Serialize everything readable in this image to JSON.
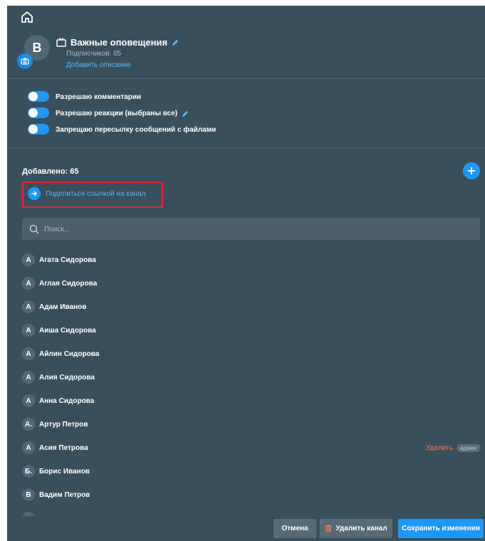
{
  "channel": {
    "avatar_letter": "B",
    "title": "Важные оповещения",
    "subscribers": "Подписчиков: 65",
    "add_description": "Добавить описание"
  },
  "options": [
    {
      "label": "Разрешаю комментарии",
      "enabled": true
    },
    {
      "label": "Разрешаю реакции (выбраны все)",
      "enabled": true
    },
    {
      "label": "Запрещаю пересылку сообщений с файлами",
      "enabled": true
    }
  ],
  "members_section": {
    "added": "Добавлено: 65",
    "share_link": "Поделиться ссылкой на канал"
  },
  "search": {
    "placeholder": "Поиск..."
  },
  "members": [
    {
      "initial": "А",
      "name": "Агата Сидорова"
    },
    {
      "initial": "А",
      "name": "Аглая Сидорова"
    },
    {
      "initial": "А",
      "name": "Адам Иванов"
    },
    {
      "initial": "А",
      "name": "Аиша Сидорова"
    },
    {
      "initial": "А",
      "name": "Айлин Сидорова"
    },
    {
      "initial": "А",
      "name": "Алия Сидорова"
    },
    {
      "initial": "А",
      "name": "Анна Сидорова"
    },
    {
      "initial": "А.",
      "name": "Артур Петров"
    },
    {
      "initial": "А",
      "name": "Асия Петрова",
      "delete": "Удалить",
      "badge": "админ"
    },
    {
      "initial": "Б.",
      "name": "Борис Иванов"
    },
    {
      "initial": "В",
      "name": "Вадим Петров"
    }
  ],
  "footer": {
    "cancel": "Отмена",
    "delete_channel": "Удалить канал",
    "save": "Сохранить изменения"
  },
  "colors": {
    "accent": "#2196f3",
    "panel": "#3a4f5c",
    "danger": "#ff7043",
    "highlight_box": "#e0272e"
  }
}
